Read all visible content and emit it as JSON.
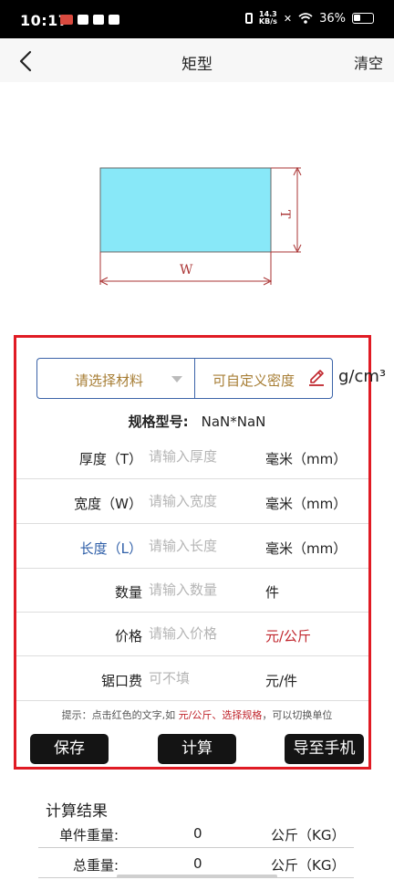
{
  "status_bar": {
    "time": "10:17",
    "net_speed_value": "14.3",
    "net_speed_unit": "KB/s",
    "battery": "36%"
  },
  "nav": {
    "title": "矩型",
    "clear_label": "清空"
  },
  "diagram": {
    "width_label": "W",
    "thickness_label": "T",
    "fill_color": "#88e8f8"
  },
  "form": {
    "material_placeholder": "请选择材料",
    "density_placeholder": "可自定义密度",
    "density_unit": "g/cm³",
    "spec_label": "规格型号:",
    "spec_value": "NaN*NaN",
    "rows": [
      {
        "label": "厚度（T）",
        "placeholder": "请输入厚度",
        "unit": "毫米（mm）"
      },
      {
        "label": "宽度（W）",
        "placeholder": "请输入宽度",
        "unit": "毫米（mm）"
      },
      {
        "label": "长度（L）",
        "placeholder": "请输入长度",
        "unit": "毫米（mm）"
      },
      {
        "label": "数量",
        "placeholder": "请输入数量",
        "unit": "件"
      },
      {
        "label": "价格",
        "placeholder": "请输入价格",
        "unit": "元/公斤"
      },
      {
        "label": "锯口费",
        "placeholder": "可不填",
        "unit": "元/件"
      }
    ],
    "hint_prefix": "提示：点击红色的文字,如 ",
    "hint_red": "元/公斤、选择规格",
    "hint_suffix": "，可以切换单位",
    "save_label": "保存",
    "calc_label": "计算",
    "export_label": "导至手机"
  },
  "results": {
    "title": "计算结果",
    "rows": [
      {
        "label": "单件重量:",
        "value": "0",
        "unit": "公斤（KG）"
      },
      {
        "label": "总重量:",
        "value": "0",
        "unit": "公斤（KG）"
      }
    ]
  },
  "colors": {
    "form_border": "#e01b24",
    "accent_blue": "#3b63a8",
    "label_gold": "#a77e35",
    "unit_red": "#c0262d"
  }
}
